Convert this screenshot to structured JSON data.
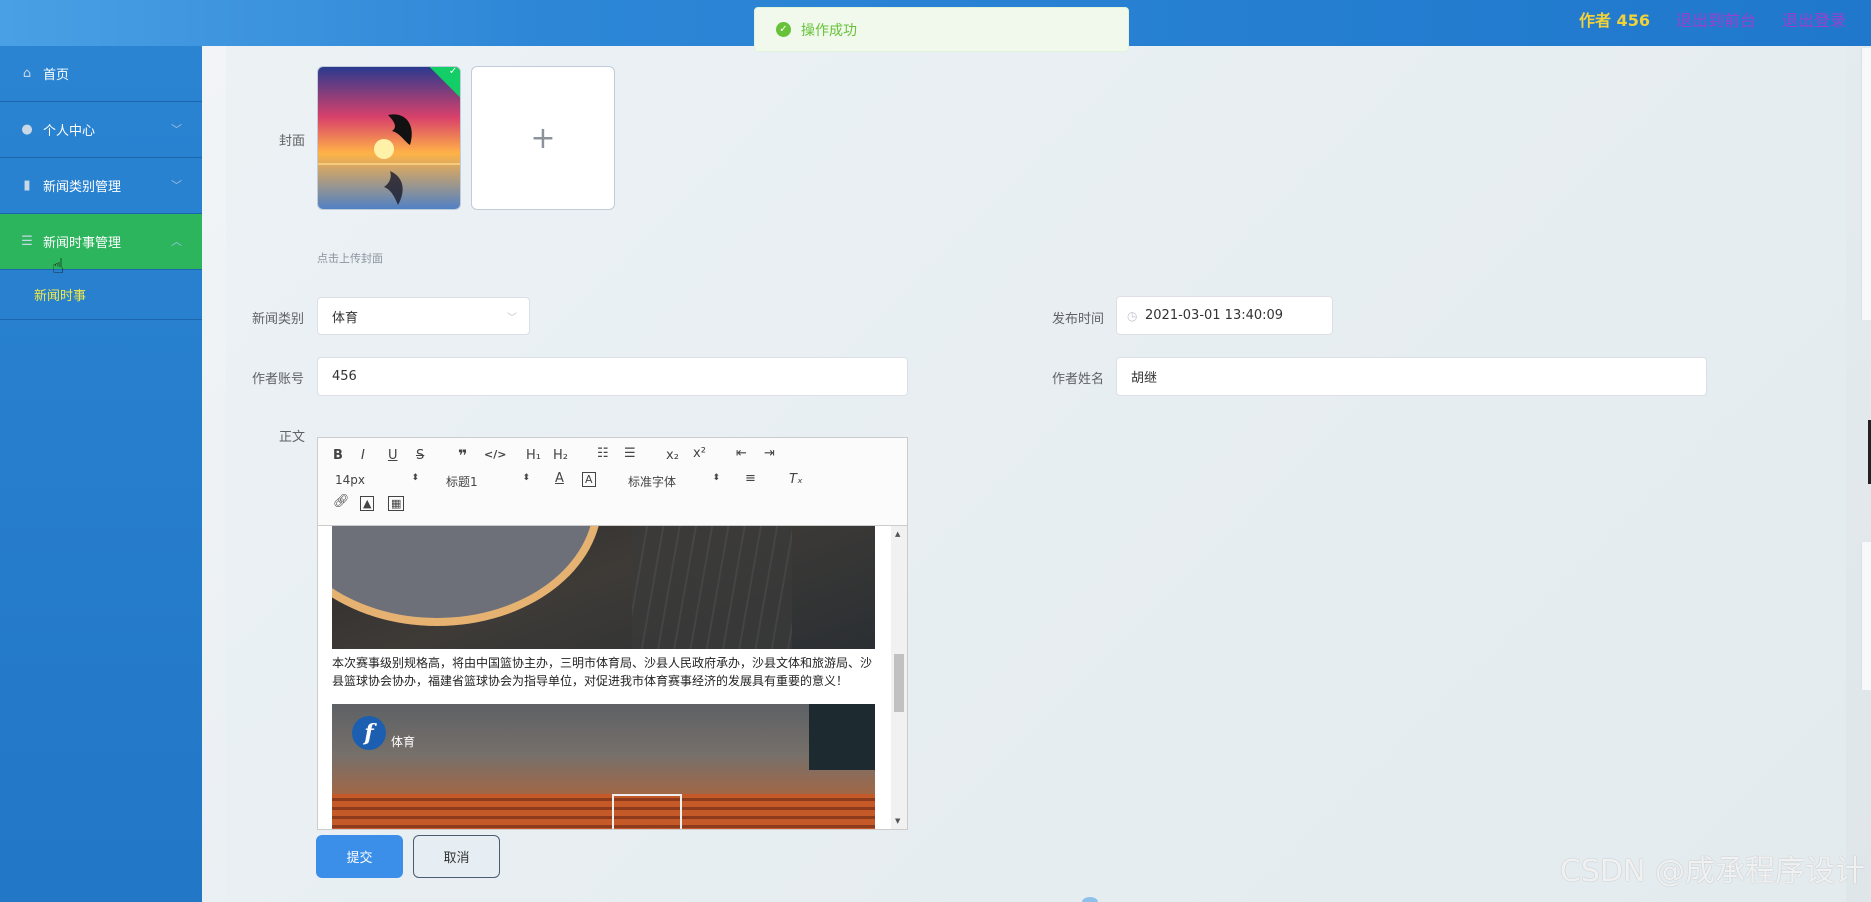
{
  "topbar": {
    "author": "作者 456",
    "to_frontend": "退出到前台",
    "logout": "退出登录"
  },
  "toast": {
    "message": "操作成功"
  },
  "sidebar": {
    "items": [
      {
        "label": "首页",
        "icon": "home-icon"
      },
      {
        "label": "个人中心",
        "icon": "user-icon"
      },
      {
        "label": "新闻类别管理",
        "icon": "bar-chart-icon"
      },
      {
        "label": "新闻时事管理",
        "icon": "list-icon"
      }
    ],
    "sub_item": "新闻时事"
  },
  "form": {
    "cover_label": "封面",
    "cover_hint": "点击上传封面",
    "category_label": "新闻类别",
    "category_value": "体育",
    "publish_label": "发布时间",
    "publish_value": "2021-03-01 13:40:09",
    "account_label": "作者账号",
    "account_value": "456",
    "name_label": "作者姓名",
    "name_value": "胡继",
    "body_label": "正文"
  },
  "editor": {
    "font_size": "14px",
    "heading": "标题1",
    "font_family": "标准字体",
    "paragraph": "本次赛事级别规格高，将由中国篮协主办，三明市体育局、沙县人民政府承办，沙县文体和旅游局、沙县篮球协会协办，福建省篮球协会为指导单位，对促进我市体育赛事经济的发展具有重要的意义！",
    "image_tag": "体育"
  },
  "buttons": {
    "submit": "提交",
    "cancel": "取消"
  },
  "watermark": "CSDN @成承程序设计",
  "colors": {
    "accent": "#3b8fe8",
    "active_menu": "#2db55d",
    "success": "#67c23a"
  }
}
